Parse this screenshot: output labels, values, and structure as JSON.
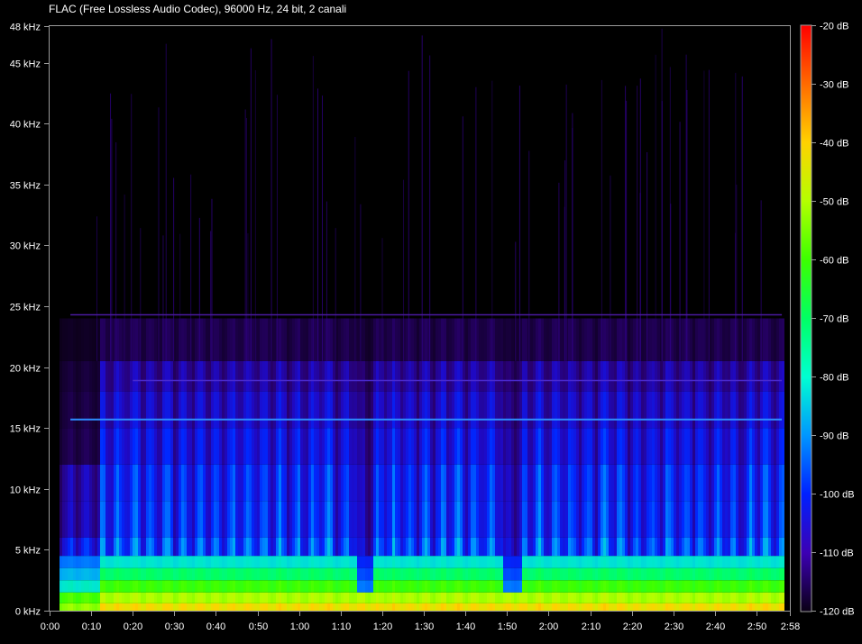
{
  "title": "FLAC (Free Lossless Audio Codec), 96000 Hz, 24 bit, 2 canali",
  "chart_data": {
    "type": "heatmap",
    "title": "FLAC (Free Lossless Audio Codec), 96000 Hz, 24 bit, 2 canali",
    "x_axis": {
      "unit": "time",
      "range_seconds": [
        0,
        178
      ],
      "tick_labels": [
        "0:00",
        "0:10",
        "0:20",
        "0:30",
        "0:40",
        "0:50",
        "1:00",
        "1:10",
        "1:20",
        "1:30",
        "1:40",
        "1:50",
        "2:00",
        "2:10",
        "2:20",
        "2:30",
        "2:40",
        "2:50",
        "2:58"
      ],
      "tick_values_seconds": [
        0,
        10,
        20,
        30,
        40,
        50,
        60,
        70,
        80,
        90,
        100,
        110,
        120,
        130,
        140,
        150,
        160,
        170,
        178
      ]
    },
    "y_axis": {
      "unit": "kHz",
      "range": [
        0,
        48
      ],
      "tick_labels": [
        "0 kHz",
        "5 kHz",
        "10 kHz",
        "15 kHz",
        "20 kHz",
        "25 kHz",
        "30 kHz",
        "35 kHz",
        "40 kHz",
        "45 kHz",
        "48 kHz"
      ],
      "tick_values": [
        0,
        5,
        10,
        15,
        20,
        25,
        30,
        35,
        40,
        45,
        48
      ]
    },
    "color_scale": {
      "unit": "dB",
      "range": [
        -120,
        -20
      ],
      "tick_labels": [
        "-20 dB",
        "-30 dB",
        "-40 dB",
        "-50 dB",
        "-60 dB",
        "-70 dB",
        "-80 dB",
        "-90 dB",
        "-100 dB",
        "-110 dB",
        "-120 dB"
      ],
      "tick_values": [
        -20,
        -30,
        -40,
        -50,
        -60,
        -70,
        -80,
        -90,
        -100,
        -110,
        -120
      ],
      "colors": [
        "#ff0000",
        "#ff6a00",
        "#ffd200",
        "#b4ff00",
        "#3cff00",
        "#00ff64",
        "#00ffd2",
        "#0096ff",
        "#0020ff",
        "#3c00b4",
        "#0a0014"
      ]
    },
    "grid": false,
    "features": {
      "audio_start_seconds": 2.5,
      "audio_end_seconds": 176.5,
      "intro_end_seconds": 12,
      "band_edge_kHz": 20.5,
      "tone_lines_kHz": [
        15.7,
        18.9,
        24.3
      ],
      "gap_segments_seconds": [
        [
          73.5,
          77.5
        ],
        [
          109,
          113
        ]
      ]
    }
  }
}
